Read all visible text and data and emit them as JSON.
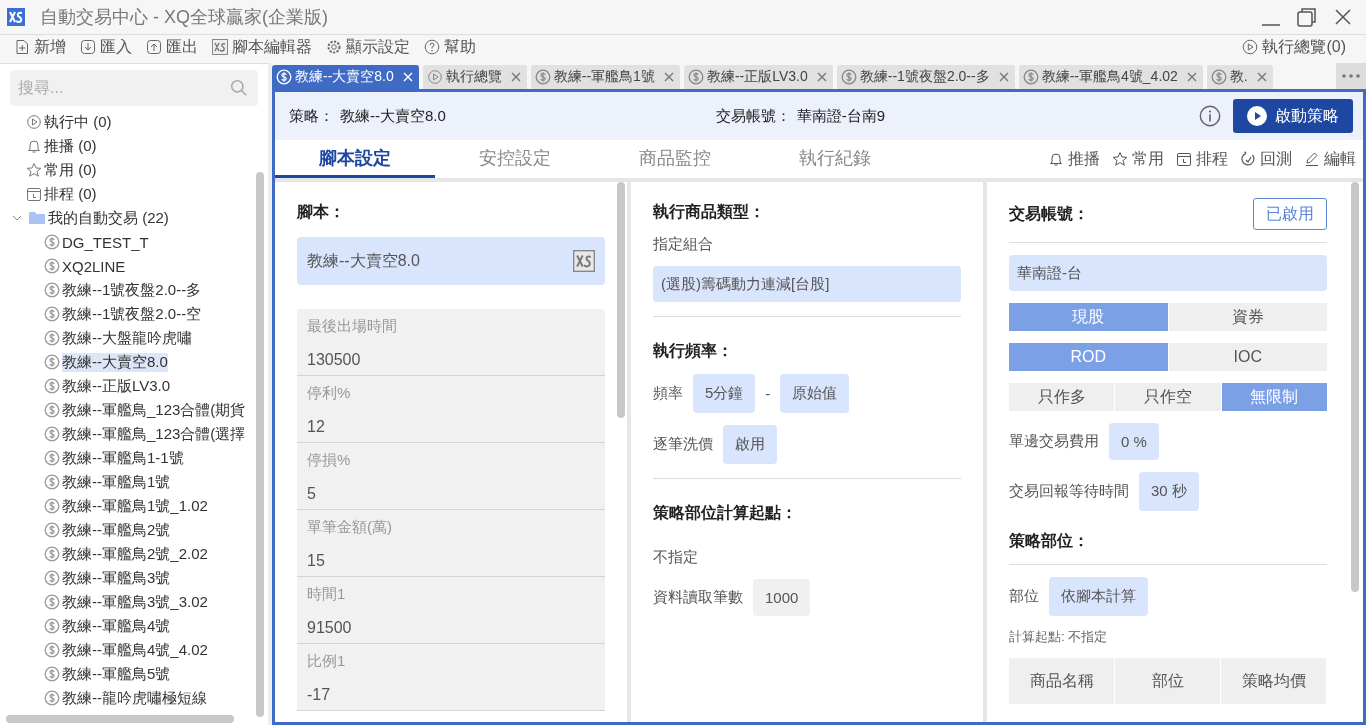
{
  "window": {
    "title": "自動交易中心 - XQ全球贏家(企業版)"
  },
  "toolbar": [
    {
      "label": "新增",
      "kind": "new"
    },
    {
      "label": "匯入",
      "kind": "import"
    },
    {
      "label": "匯出",
      "kind": "export"
    },
    {
      "label": "腳本編輯器",
      "kind": "editor"
    },
    {
      "label": "顯示設定",
      "kind": "settings"
    },
    {
      "label": "幫助",
      "kind": "help"
    }
  ],
  "toolbar_right": {
    "label": "執行總覽(0)"
  },
  "sidebar": {
    "search": {
      "placeholder": "搜尋..."
    },
    "items": [
      {
        "label": "執行中 (0)",
        "kind": "running"
      },
      {
        "label": "推播 (0)",
        "kind": "push"
      },
      {
        "label": "常用 (0)",
        "kind": "favorite"
      },
      {
        "label": "排程 (0)",
        "kind": "schedule"
      }
    ],
    "folder": {
      "label": "我的自動交易 (22)",
      "expanded": true,
      "children": [
        {
          "label": "DG_TEST_T",
          "selected": false
        },
        {
          "label": "XQ2LINE",
          "selected": false
        },
        {
          "label": "教練--1號夜盤2.0--多",
          "selected": false
        },
        {
          "label": "教練--1號夜盤2.0--空",
          "selected": false
        },
        {
          "label": "教練--大盤龍吟虎嘯",
          "selected": false
        },
        {
          "label": "教練--大賣空8.0",
          "selected": true
        },
        {
          "label": "教練--正版LV3.0",
          "selected": false
        },
        {
          "label": "教練--軍艦鳥_123合體(期貨",
          "selected": false
        },
        {
          "label": "教練--軍艦鳥_123合體(選擇",
          "selected": false
        },
        {
          "label": "教練--軍艦鳥1-1號",
          "selected": false
        },
        {
          "label": "教練--軍艦鳥1號",
          "selected": false
        },
        {
          "label": "教練--軍艦鳥1號_1.02",
          "selected": false
        },
        {
          "label": "教練--軍艦鳥2號",
          "selected": false
        },
        {
          "label": "教練--軍艦鳥2號_2.02",
          "selected": false
        },
        {
          "label": "教練--軍艦鳥3號",
          "selected": false
        },
        {
          "label": "教練--軍艦鳥3號_3.02",
          "selected": false
        },
        {
          "label": "教練--軍艦鳥4號",
          "selected": false
        },
        {
          "label": "教練--軍艦鳥4號_4.02",
          "selected": false
        },
        {
          "label": "教練--軍艦鳥5號",
          "selected": false
        },
        {
          "label": "教練--龍吟虎嘯極短線",
          "selected": false
        }
      ]
    }
  },
  "tabs": [
    {
      "label": "教練--大賣空8.0",
      "kind": "strategy",
      "selected": true
    },
    {
      "label": "執行總覽",
      "kind": "overview",
      "selected": false
    },
    {
      "label": "教練--軍艦鳥1號",
      "kind": "strategy",
      "selected": false
    },
    {
      "label": "教練--正版LV3.0",
      "kind": "strategy",
      "selected": false
    },
    {
      "label": "教練--1號夜盤2.0--多",
      "kind": "strategy",
      "selected": false
    },
    {
      "label": "教練--軍艦鳥4號_4.02",
      "kind": "strategy",
      "selected": false
    },
    {
      "label": "教.",
      "kind": "strategy",
      "selected": false
    }
  ],
  "header": {
    "strategy_label": "策略：",
    "strategy_name": "教練--大賣空8.0",
    "account_label": "交易帳號：",
    "account_value": "華南證-台南9",
    "start_button": "啟動策略"
  },
  "subtabs": [
    {
      "label": "腳本設定",
      "selected": true
    },
    {
      "label": "安控設定",
      "selected": false
    },
    {
      "label": "商品監控",
      "selected": false
    },
    {
      "label": "執行紀錄",
      "selected": false
    }
  ],
  "actions": [
    {
      "label": "推播",
      "kind": "push"
    },
    {
      "label": "常用",
      "kind": "favorite"
    },
    {
      "label": "排程",
      "kind": "schedule"
    },
    {
      "label": "回測",
      "kind": "backtest"
    },
    {
      "label": "編輯",
      "kind": "edit"
    }
  ],
  "script_panel": {
    "title": "腳本：",
    "script_name": "教練--大賣空8.0",
    "params": [
      {
        "label": "最後出場時間",
        "value": "130500"
      },
      {
        "label": "停利%",
        "value": "12"
      },
      {
        "label": "停損%",
        "value": "5"
      },
      {
        "label": "單筆金額(萬)",
        "value": "15"
      },
      {
        "label": "時間1",
        "value": "91500"
      },
      {
        "label": "比例1",
        "value": "-17"
      }
    ]
  },
  "exec_panel": {
    "type_title": "執行商品類型：",
    "type_value": "指定組合",
    "portfolio": "(選股)籌碼動力連減[台股]",
    "freq_title": "執行頻率：",
    "freq_label": "頻率",
    "freq_value": "5分鐘",
    "freq_sep": "-",
    "freq_mode": "原始值",
    "tick_label": "逐筆洗價",
    "tick_value": "啟用",
    "calc_title": "策略部位計算起點：",
    "calc_value": "不指定",
    "read_label": "資料讀取筆數",
    "read_value": "1000"
  },
  "account_panel": {
    "title": "交易帳號：",
    "status": "已啟用",
    "account": "華南證-台",
    "segments": [
      [
        {
          "label": "現股",
          "selected": true
        },
        {
          "label": "資券",
          "selected": false
        }
      ],
      [
        {
          "label": "ROD",
          "selected": true
        },
        {
          "label": "IOC",
          "selected": false
        }
      ],
      [
        {
          "label": "只作多",
          "selected": false
        },
        {
          "label": "只作空",
          "selected": false
        },
        {
          "label": "無限制",
          "selected": true
        }
      ]
    ],
    "fee_label": "單邊交易費用",
    "fee_value": "0 %",
    "wait_label": "交易回報等待時間",
    "wait_value": "30 秒",
    "position_title": "策略部位：",
    "position_label": "部位",
    "position_value": "依腳本計算",
    "calc_note": "計算起點: 不指定",
    "columns": [
      "商品名稱",
      "部位",
      "策略均價"
    ]
  }
}
